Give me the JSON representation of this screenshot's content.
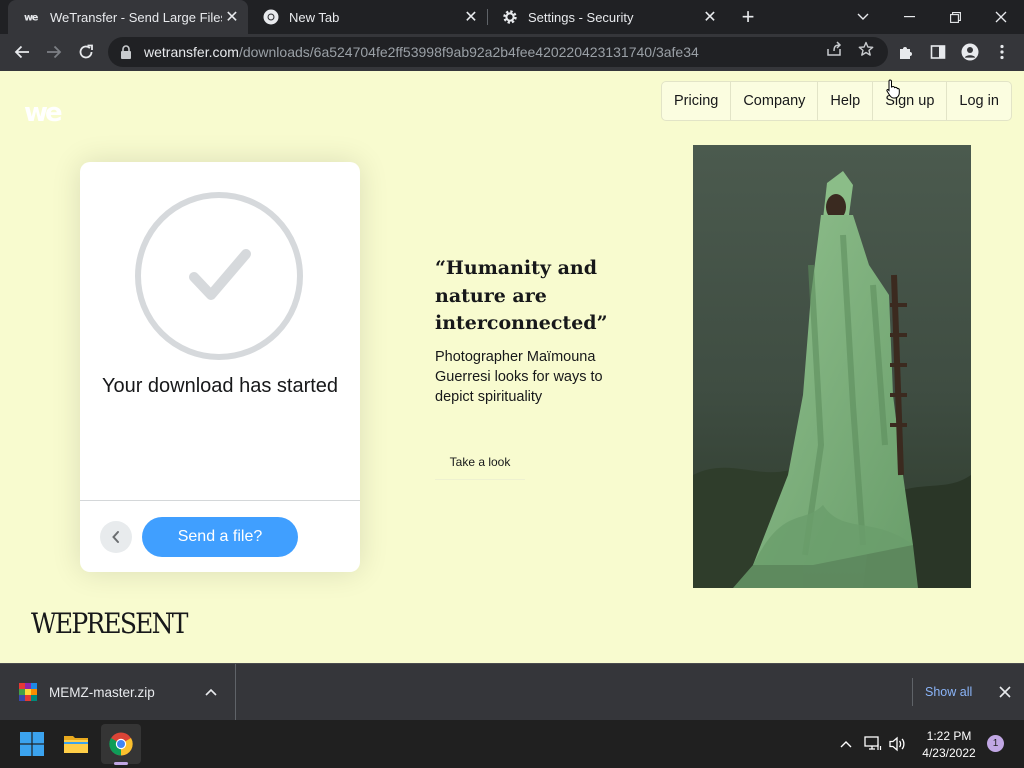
{
  "browser": {
    "tabs": [
      {
        "label": "WeTransfer - Send Large Files & S",
        "icon": "wetransfer-icon",
        "active": true
      },
      {
        "label": "New Tab",
        "icon": "chrome-icon",
        "active": false
      },
      {
        "label": "Settings - Security",
        "icon": "gear-icon",
        "active": false
      }
    ],
    "address": {
      "host": "wetransfer.com",
      "path": "/downloads/6a524704fe2ff53998f9ab92a2b4fee420220423131740/3afe34"
    }
  },
  "page": {
    "logo": "we",
    "nav": [
      "Pricing",
      "Company",
      "Help",
      "Sign up",
      "Log in"
    ],
    "card": {
      "status": "Your download has started",
      "send_button": "Send a file?"
    },
    "feature": {
      "quote": "“Humanity and nature are interconnected”",
      "description": "Photographer Maïmouna Guerresi looks for ways to depict spirituality",
      "cta": "Take a look"
    },
    "footer_brand": "WEPRESENT"
  },
  "downloads": {
    "file": "MEMZ-master.zip",
    "show_all": "Show all"
  },
  "taskbar": {
    "time": "1:22 PM",
    "date": "4/23/2022",
    "notifications": "1"
  },
  "colors": {
    "page_bg": "#f8fbcf",
    "accent": "#409fff",
    "check": "#d6d9dc"
  }
}
